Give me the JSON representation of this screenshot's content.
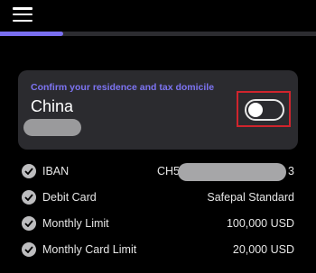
{
  "header": {
    "menu_icon": "hamburger-menu-icon"
  },
  "progress": {
    "fraction": 0.2,
    "fill_color": "#7a6ff0"
  },
  "residence_card": {
    "title": "Confirm your residence and tax domicile",
    "country": "China",
    "toggle_on": false,
    "accent_color": "#7d74f2",
    "highlight_color": "#d0242d"
  },
  "details": {
    "iban": {
      "label": "IBAN",
      "value_prefix": "CH5",
      "value_suffix": "3"
    },
    "debit_card": {
      "label": "Debit Card",
      "value": "Safepal Standard"
    },
    "monthly_limit": {
      "label": "Monthly Limit",
      "value": "100,000 USD"
    },
    "monthly_card_limit": {
      "label": "Monthly Card Limit",
      "value": "20,000 USD"
    },
    "row_icon": "check-circle-icon"
  }
}
